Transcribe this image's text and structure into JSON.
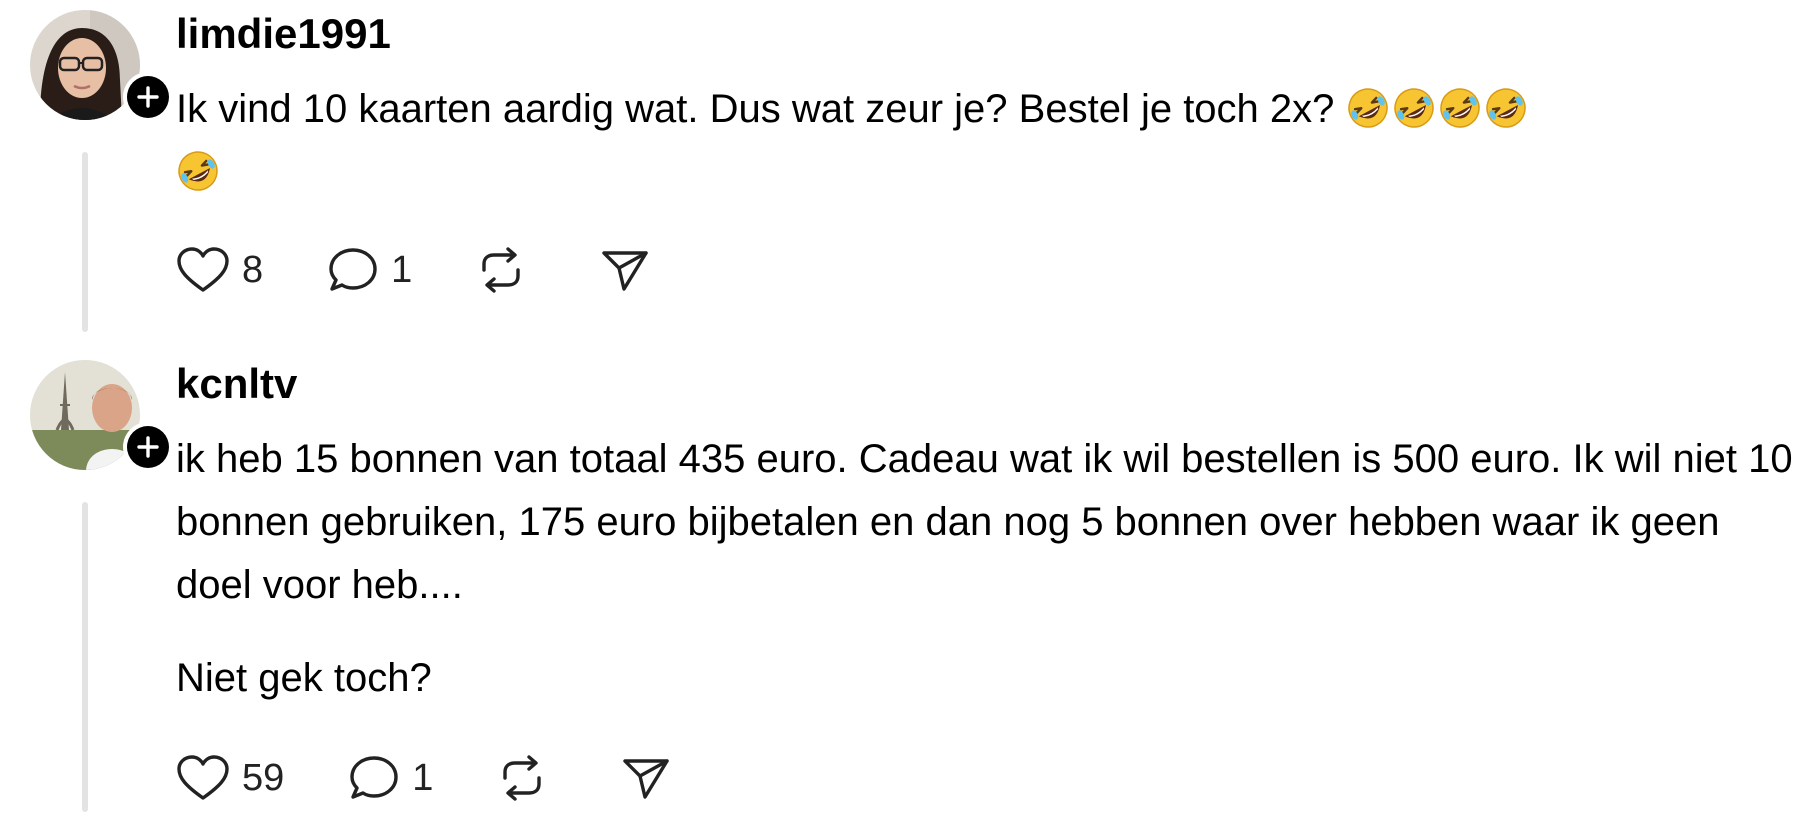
{
  "posts": [
    {
      "username": "limdie1991",
      "text": "Ik vind 10 kaarten aardig wat. Dus wat zeur je? Bestel je toch 2x? ",
      "emoji_count_line1": 4,
      "emoji_count_line2": 1,
      "emoji_name": "rolling-on-floor-laughing-emoji",
      "likes": "8",
      "replies": "1"
    },
    {
      "username": "kcnltv",
      "text": "ik heb 15 bonnen van totaal 435 euro. Cadeau wat ik wil bestellen is 500 euro. Ik wil niet 10 bonnen gebruiken, 175 euro bijbetalen en dan nog 5 bonnen over hebben waar ik geen doel voor heb....",
      "text2": "Niet gek toch?",
      "likes": "59",
      "replies": "1"
    }
  ],
  "colors": {
    "text": "#000000",
    "thread_line": "#e3e3e3",
    "icon": "#222222"
  },
  "icons": [
    "heart-icon",
    "comment-icon",
    "repost-icon",
    "share-icon",
    "plus-icon"
  ]
}
